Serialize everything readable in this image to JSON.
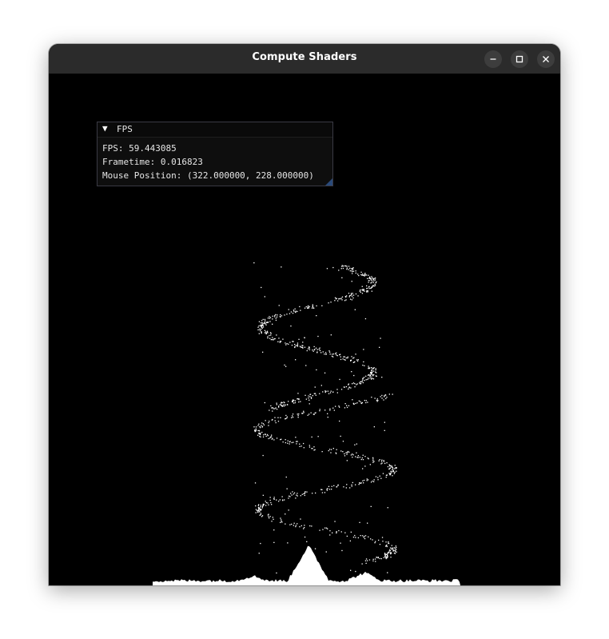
{
  "window": {
    "title": "Compute Shaders",
    "controls": {
      "minimize_icon": "minimize-icon",
      "maximize_icon": "maximize-icon",
      "close_icon": "close-icon"
    }
  },
  "fps_panel": {
    "title": "FPS",
    "collapse_glyph": "▼",
    "fps_text": "FPS: 59.443085",
    "frametime_text": "Frametime: 0.016823",
    "mouse_text": "Mouse Position: (322.000000, 228.000000)"
  },
  "colors": {
    "titlebar": "#2b2b2b",
    "canvas_background": "#000000",
    "particles": "#ffffff",
    "imgui_background": "#0f0f0f",
    "imgui_border": "#3a3a44",
    "imgui_resize_grip": "#2a4a7a"
  }
}
